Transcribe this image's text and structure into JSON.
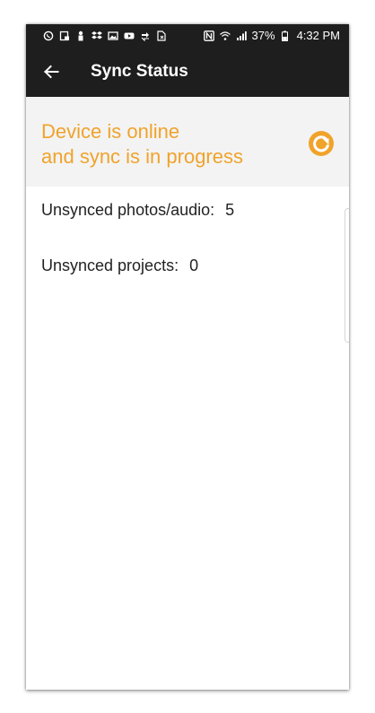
{
  "status_bar": {
    "battery": "37%",
    "time": "4:32 PM",
    "icons_left": [
      "whatsapp-icon",
      "screenshot-icon",
      "person-icon",
      "dropbox-icon",
      "gallery-icon",
      "youtube-icon",
      "sync-arrows-icon",
      "file-icon"
    ],
    "icons_right": [
      "nfc-icon",
      "wifi-icon",
      "signal-icon",
      "battery-icon"
    ]
  },
  "app_bar": {
    "title": "Sync Status",
    "back_icon": "back-arrow-icon"
  },
  "banner": {
    "line1": "Device is online",
    "line2": "and sync is in progress",
    "color": "#f0a32b",
    "icon": "refresh-icon"
  },
  "stats": {
    "photos_label": "Unsynced photos/audio:",
    "photos_value": "5",
    "projects_label": "Unsynced projects:",
    "projects_value": "0"
  },
  "colors": {
    "app_bar_bg": "#1e1e1e",
    "banner_bg": "#f3f3f3",
    "accent": "#f0a32b"
  }
}
